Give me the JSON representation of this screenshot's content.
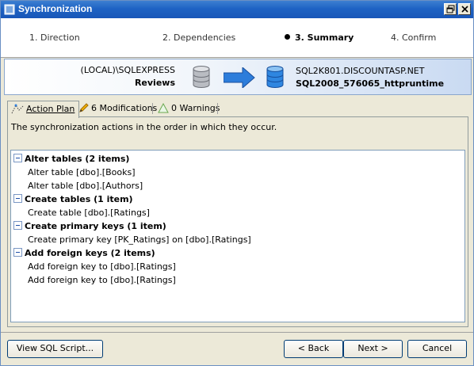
{
  "window": {
    "title": "Synchronization"
  },
  "steps": [
    {
      "label": "1. Direction"
    },
    {
      "label": "2. Dependencies"
    },
    {
      "label": "3. Summary",
      "active": true
    },
    {
      "label": "4. Confirm"
    }
  ],
  "connection": {
    "source_server": "(LOCAL)\\SQLEXPRESS",
    "source_db": "Reviews",
    "target_server": "SQL2K801.DISCOUNTASP.NET",
    "target_db": "SQL2008_576065_httpruntime"
  },
  "tabs": {
    "action_plan": "Action Plan",
    "modifications": "6 Modifications",
    "warnings": "0 Warnings"
  },
  "description": "The synchronization actions in the order in which they occur.",
  "groups": [
    {
      "title": "Alter tables (2 items)",
      "items": [
        "Alter table [dbo].[Books]",
        "Alter table [dbo].[Authors]"
      ]
    },
    {
      "title": "Create tables (1 item)",
      "items": [
        "Create table [dbo].[Ratings]"
      ]
    },
    {
      "title": "Create primary keys (1 item)",
      "items": [
        "Create primary key [PK_Ratings] on [dbo].[Ratings]"
      ]
    },
    {
      "title": "Add foreign keys (2 items)",
      "items": [
        "Add foreign key to [dbo].[Ratings]",
        "Add foreign key to [dbo].[Ratings]"
      ]
    }
  ],
  "buttons": {
    "view_sql": "View SQL Script...",
    "back": "< Back",
    "next": "Next >",
    "cancel": "Cancel"
  },
  "colors": {
    "title_bar": "#1e63c4",
    "accent_blue": "#2d7ddb"
  }
}
